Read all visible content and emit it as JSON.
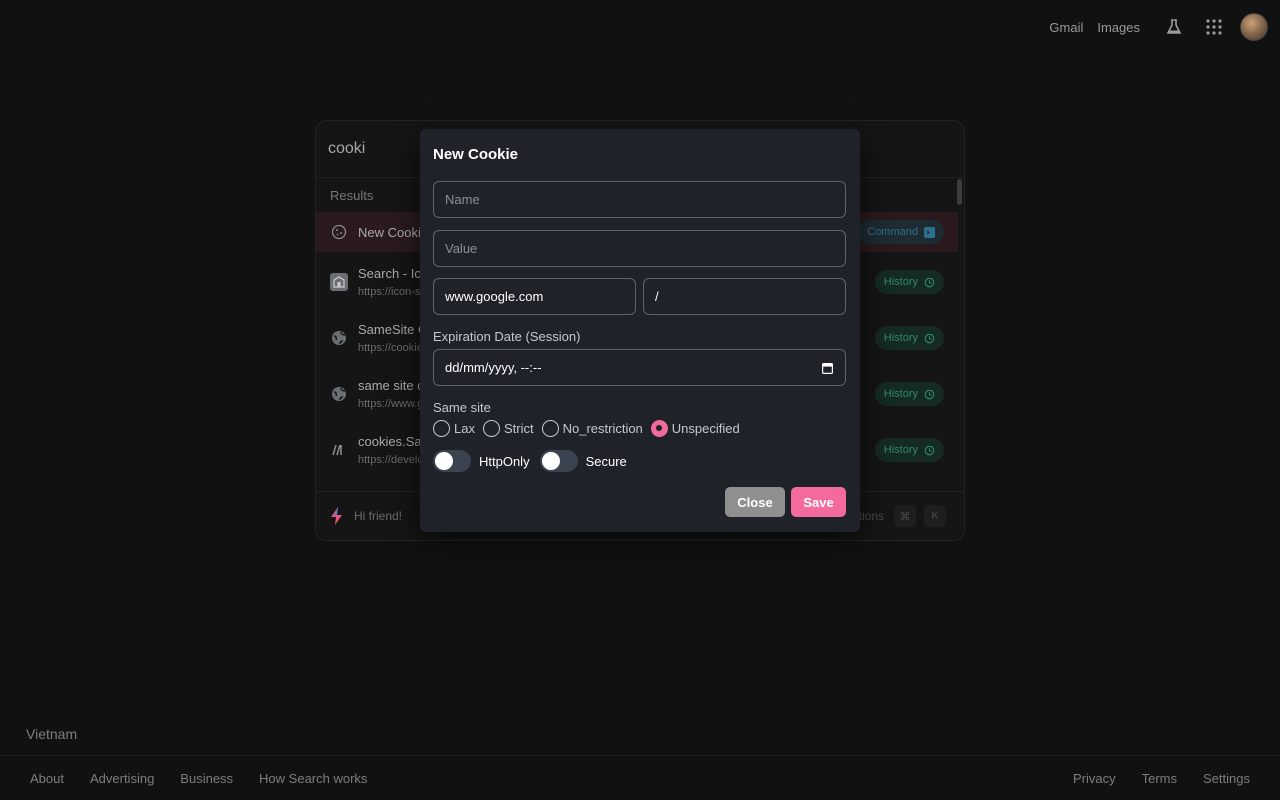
{
  "topbar": {
    "gmail": "Gmail",
    "images": "Images",
    "labs_icon": "flask-icon",
    "apps_icon": "grid-icon",
    "avatar_icon": "avatar"
  },
  "palette": {
    "query": "cooki",
    "section": "Results",
    "rows": [
      {
        "title": "New Cookie",
        "subtitle": "",
        "tag": "Command",
        "icon": "cookie-icon"
      },
      {
        "title": "Search - Ic",
        "subtitle": "https://icon-s",
        "tag": "History",
        "icon": "building-icon"
      },
      {
        "title": "SameSite C",
        "subtitle": "https://cookie",
        "tag": "History",
        "icon": "globe-icon"
      },
      {
        "title": "same site c",
        "subtitle": "https://www.g",
        "tag": "History",
        "icon": "globe-icon"
      },
      {
        "title": "cookies.Sar",
        "subtitle": "https://develc",
        "tag": "History",
        "icon": "mdn-icon"
      }
    ],
    "footer_text": "Hi friend!",
    "footer_hint": "tions",
    "kbd_cmd": "⌘",
    "kbd_k": "K"
  },
  "modal": {
    "title": "New Cookie",
    "name_placeholder": "Name",
    "value_placeholder": "Value",
    "domain_value": "www.google.com",
    "path_value": "/",
    "expiration_label": "Expiration Date (Session)",
    "expiration_value": "dd/mm/yyyy, --:--",
    "same_site_label": "Same site",
    "same_site_options": [
      "Lax",
      "Strict",
      "No_restriction",
      "Unspecified"
    ],
    "same_site_selected": "Unspecified",
    "httponly_label": "HttpOnly",
    "secure_label": "Secure",
    "close_label": "Close",
    "save_label": "Save"
  },
  "footer": {
    "country": "Vietnam",
    "left_links": [
      "About",
      "Advertising",
      "Business",
      "How Search works"
    ],
    "right_links": [
      "Privacy",
      "Terms",
      "Settings"
    ]
  },
  "colors": {
    "accent_pink": "#f26b9c",
    "history_green": "#2f8a67",
    "command_blue": "#2d6f8c"
  }
}
